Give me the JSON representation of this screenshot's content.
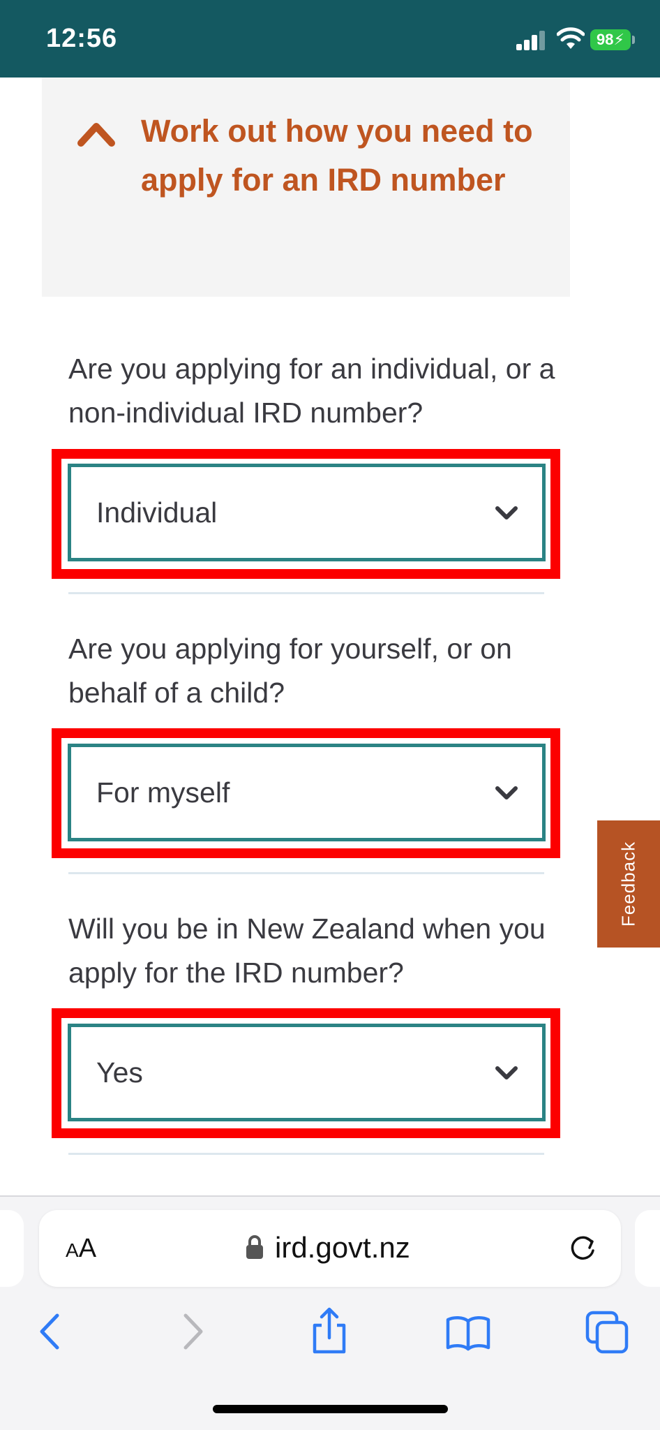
{
  "status_bar": {
    "time": "12:56",
    "battery": "98"
  },
  "accordion": {
    "title": "Work out how you need to apply for an IRD number",
    "icon": "chevron-up-icon"
  },
  "questions": [
    {
      "label": "Are you applying for an individual, or a non-individual IRD number?",
      "selected": "Individual"
    },
    {
      "label": "Are you applying for yourself, or on behalf of a child?",
      "selected": "For myself"
    },
    {
      "label": "Will you be in New Zealand when you apply for the IRD number?",
      "selected": "Yes"
    }
  ],
  "feedback": {
    "label": "Feedback"
  },
  "browser": {
    "aa_large": "A",
    "aa_small": "A",
    "url": "ird.govt.nz"
  },
  "colors": {
    "status_bar": "#145961",
    "accent_orange": "#bf5520",
    "select_border": "#2b8384",
    "highlight_red": "#fc0000",
    "link_blue": "#2f7bf6"
  }
}
